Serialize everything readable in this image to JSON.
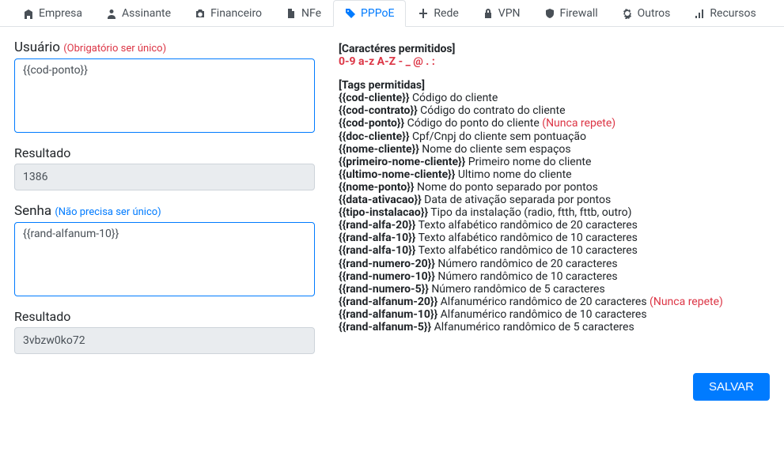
{
  "tabs": [
    {
      "label": "Empresa",
      "icon": "building-icon"
    },
    {
      "label": "Assinante",
      "icon": "user-icon"
    },
    {
      "label": "Financeiro",
      "icon": "camera-icon"
    },
    {
      "label": "NFe",
      "icon": "file-icon"
    },
    {
      "label": "PPPoE",
      "icon": "tag-icon",
      "active": true
    },
    {
      "label": "Rede",
      "icon": "network-icon"
    },
    {
      "label": "VPN",
      "icon": "lock-icon"
    },
    {
      "label": "Firewall",
      "icon": "shield-icon"
    },
    {
      "label": "Outros",
      "icon": "gear-icon"
    },
    {
      "label": "Recursos",
      "icon": "bars-icon"
    }
  ],
  "usuario": {
    "label": "Usuário",
    "hint": "(Obrigatório ser único)",
    "value": "{{cod-ponto}}",
    "result_label": "Resultado",
    "result_value": "1386"
  },
  "senha": {
    "label": "Senha",
    "hint": "(Não precisa ser único)",
    "value": "{{rand-alfanum-10}}",
    "result_label": "Resultado",
    "result_value": "3vbzw0ko72"
  },
  "help": {
    "chars_title": "[Caractéres permitidos]",
    "chars_allowed": "0-9 a-z A-Z - _ @ . :",
    "tags_title": "[Tags permitidas]",
    "lines": [
      {
        "tag": "{{cod-cliente}}",
        "desc": " Código do cliente"
      },
      {
        "tag": "{{cod-contrato}}",
        "desc": " Código do contrato do cliente"
      },
      {
        "tag": "{{cod-ponto}}",
        "desc": " Código do ponto do cliente ",
        "note": "(Nunca repete)"
      },
      {
        "tag": "{{doc-cliente}}",
        "desc": " Cpf/Cnpj do cliente sem pontuação"
      },
      {
        "tag": "{{nome-cliente}}",
        "desc": " Nome do cliente sem espaços"
      },
      {
        "tag": "{{primeiro-nome-cliente}}",
        "desc": " Primeiro nome do cliente"
      },
      {
        "tag": "{{ultimo-nome-cliente}}",
        "desc": " Ultimo nome do cliente"
      },
      {
        "tag": "{{nome-ponto}}",
        "desc": " Nome do ponto separado por pontos"
      },
      {
        "tag": "{{data-ativacao}}",
        "desc": " Data de ativação separada por pontos"
      },
      {
        "tag": "{{tipo-instalacao}}",
        "desc": " Tipo da instalação (radio, ftth, fttb, outro)"
      },
      {
        "tag": "{{rand-alfa-20}}",
        "desc": " Texto alfabético randômico de 20 caracteres"
      },
      {
        "tag": "{{rand-alfa-10}}",
        "desc": " Texto alfabético randômico de 10 caracteres"
      },
      {
        "tag": "{{rand-alfa-10}}",
        "desc": " Texto alfabético randômico de 10 caracteres"
      },
      {
        "tag": "{{rand-numero-20}}",
        "desc": " Número randômico de 20 caracteres"
      },
      {
        "tag": "{{rand-numero-10}}",
        "desc": " Número randômico de 10 caracteres"
      },
      {
        "tag": "{{rand-numero-5}}",
        "desc": " Número randômico de 5 caracteres"
      },
      {
        "tag": "{{rand-alfanum-20}}",
        "desc": " Alfanumérico randômico de 20 caracteres ",
        "note": "(Nunca repete)"
      },
      {
        "tag": "{{rand-alfanum-10}}",
        "desc": " Alfanumérico randômico de 10 caracteres"
      },
      {
        "tag": "{{rand-alfanum-5}}",
        "desc": " Alfanumérico randômico de 5 caracteres"
      }
    ]
  },
  "footer": {
    "save_label": "SALVAR"
  }
}
